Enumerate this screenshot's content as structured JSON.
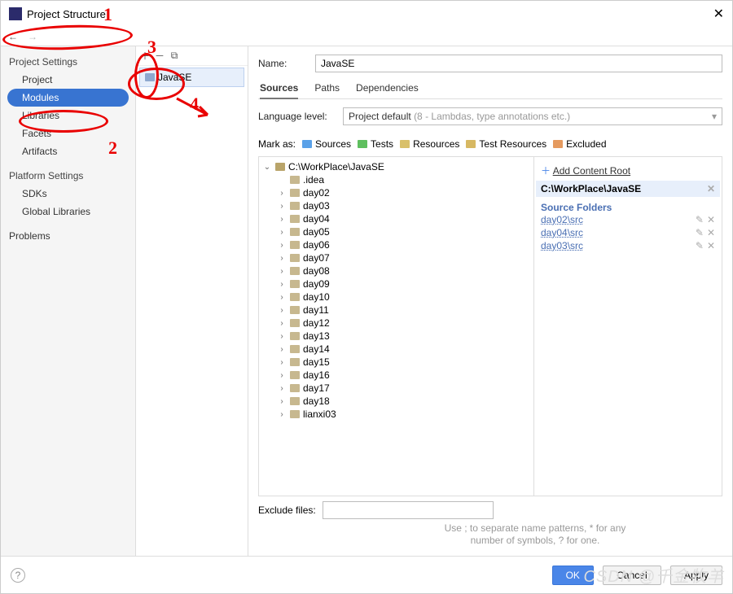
{
  "title": "Project Structure",
  "sidebar": {
    "section1": "Project Settings",
    "items1": [
      "Project",
      "Modules",
      "Libraries",
      "Facets",
      "Artifacts"
    ],
    "section2": "Platform Settings",
    "items2": [
      "SDKs",
      "Global Libraries"
    ],
    "section3": "Problems"
  },
  "module_list": [
    "JavaSE"
  ],
  "main": {
    "name_label": "Name:",
    "name_value": "JavaSE",
    "tabs": [
      "Sources",
      "Paths",
      "Dependencies"
    ],
    "lang_label": "Language level:",
    "lang_value": "Project default",
    "lang_hint": "(8 - Lambdas, type annotations etc.)",
    "mark_label": "Mark as:",
    "marks": [
      {
        "label": "Sources",
        "color": "#5aa1e8"
      },
      {
        "label": "Tests",
        "color": "#5fbf5f"
      },
      {
        "label": "Resources",
        "color": "#d9c06a"
      },
      {
        "label": "Test Resources",
        "color": "#d7b862"
      },
      {
        "label": "Excluded",
        "color": "#e59a5f"
      }
    ],
    "tree_root": "C:\\WorkPlace\\JavaSE",
    "tree": [
      ".idea",
      "day02",
      "day03",
      "day04",
      "day05",
      "day06",
      "day07",
      "day08",
      "day09",
      "day10",
      "day11",
      "day12",
      "day13",
      "day14",
      "day15",
      "day16",
      "day17",
      "day18",
      "lianxi03"
    ],
    "add_root": "Add Content Root",
    "cr_head": "C:\\WorkPlace\\JavaSE",
    "sf_head": "Source Folders",
    "source_folders": [
      "day02\\src",
      "day04\\src",
      "day03\\src"
    ],
    "excl_label": "Exclude files:",
    "excl_hint1": "Use ; to separate name patterns, * for any",
    "excl_hint2": "number of symbols, ? for one."
  },
  "footer": {
    "ok": "OK",
    "cancel": "Cancel",
    "apply": "Apply"
  },
  "anno": {
    "a1": "1",
    "a2": "2",
    "a3": "3",
    "a4": "4"
  },
  "watermark": "CSDN @千金牧羊"
}
